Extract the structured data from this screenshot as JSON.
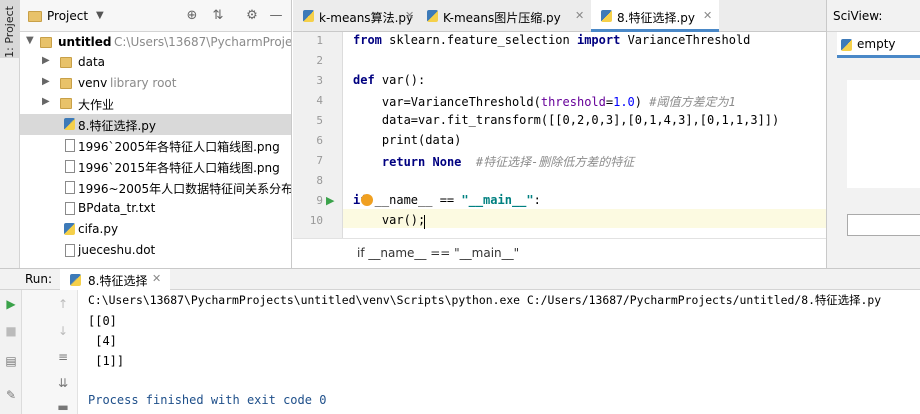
{
  "left_strip": {
    "project_tab": "1: Project"
  },
  "project_panel": {
    "title": "Project",
    "tree": [
      {
        "label": "untitled",
        "extra": "C:\\Users\\13687\\PycharmProjec",
        "kind": "root"
      },
      {
        "label": "data",
        "kind": "folder"
      },
      {
        "label": "venv",
        "extra": "library root",
        "kind": "folder"
      },
      {
        "label": "大作业",
        "kind": "folder"
      },
      {
        "label": "8.特征选择.py",
        "kind": "py",
        "selected": true
      },
      {
        "label": "1996`2005年各特征人口箱线图.png",
        "kind": "file"
      },
      {
        "label": "1996`2015年各特征人口箱线图.png",
        "kind": "file"
      },
      {
        "label": "1996~2005年人口数据特征间关系分布图",
        "kind": "file"
      },
      {
        "label": "BPdata_tr.txt",
        "kind": "file"
      },
      {
        "label": "cifa.py",
        "kind": "py"
      },
      {
        "label": "jueceshu.dot",
        "kind": "file"
      }
    ]
  },
  "editor": {
    "tabs": [
      {
        "label": "k-means算法.py"
      },
      {
        "label": "K-means图片压缩.py"
      },
      {
        "label": "8.特征选择.py",
        "active": true
      }
    ],
    "line_numbers": [
      "1",
      "2",
      "3",
      "4",
      "5",
      "6",
      "7",
      "8",
      "9",
      "10"
    ],
    "code": {
      "l1_from": "from",
      "l1_mod": " sklearn.feature_selection ",
      "l1_import": "import",
      "l1_name": " VarianceThreshold",
      "l3_def": "def",
      "l3_name": " var():",
      "l4_a": "    var=VarianceThreshold(",
      "l4_param": "threshold",
      "l4_eq": "=",
      "l4_num": "1.0",
      "l4_close": ") ",
      "l4_comment": "#阈值方差定为1",
      "l5": "    data=var.fit_transform([[0,2,0,3],[0,1,4,3],[0,1,1,3]])",
      "l6": "    print(data)",
      "l7_indent": "    ",
      "l7_return": "return",
      "l7_none": " None",
      "l7_comment": "  #特征选择-删除低方差的特征",
      "l9_if": "if",
      "l9_mid": " __name__ == ",
      "l9_str": "\"__main__\"",
      "l9_colon": ":",
      "l10": "    var();"
    },
    "breadcrumb": "if __name__ == \"__main__\""
  },
  "sciview": {
    "title": "SciView:",
    "tab": "empty"
  },
  "run": {
    "label": "Run:",
    "tab": "8.特征选择",
    "output": [
      "C:\\Users\\13687\\PycharmProjects\\untitled\\venv\\Scripts\\python.exe C:/Users/13687/PycharmProjects/untitled/8.特征选择.py",
      "[[0]",
      " [4]",
      " [1]]",
      "",
      "Process finished with exit code 0"
    ]
  },
  "colors": {
    "accent": "#4a88c7",
    "keyword": "#000080",
    "number": "#0000ff",
    "string": "#008080",
    "comment": "#8c8c8c",
    "current_line": "#fcfae1"
  }
}
